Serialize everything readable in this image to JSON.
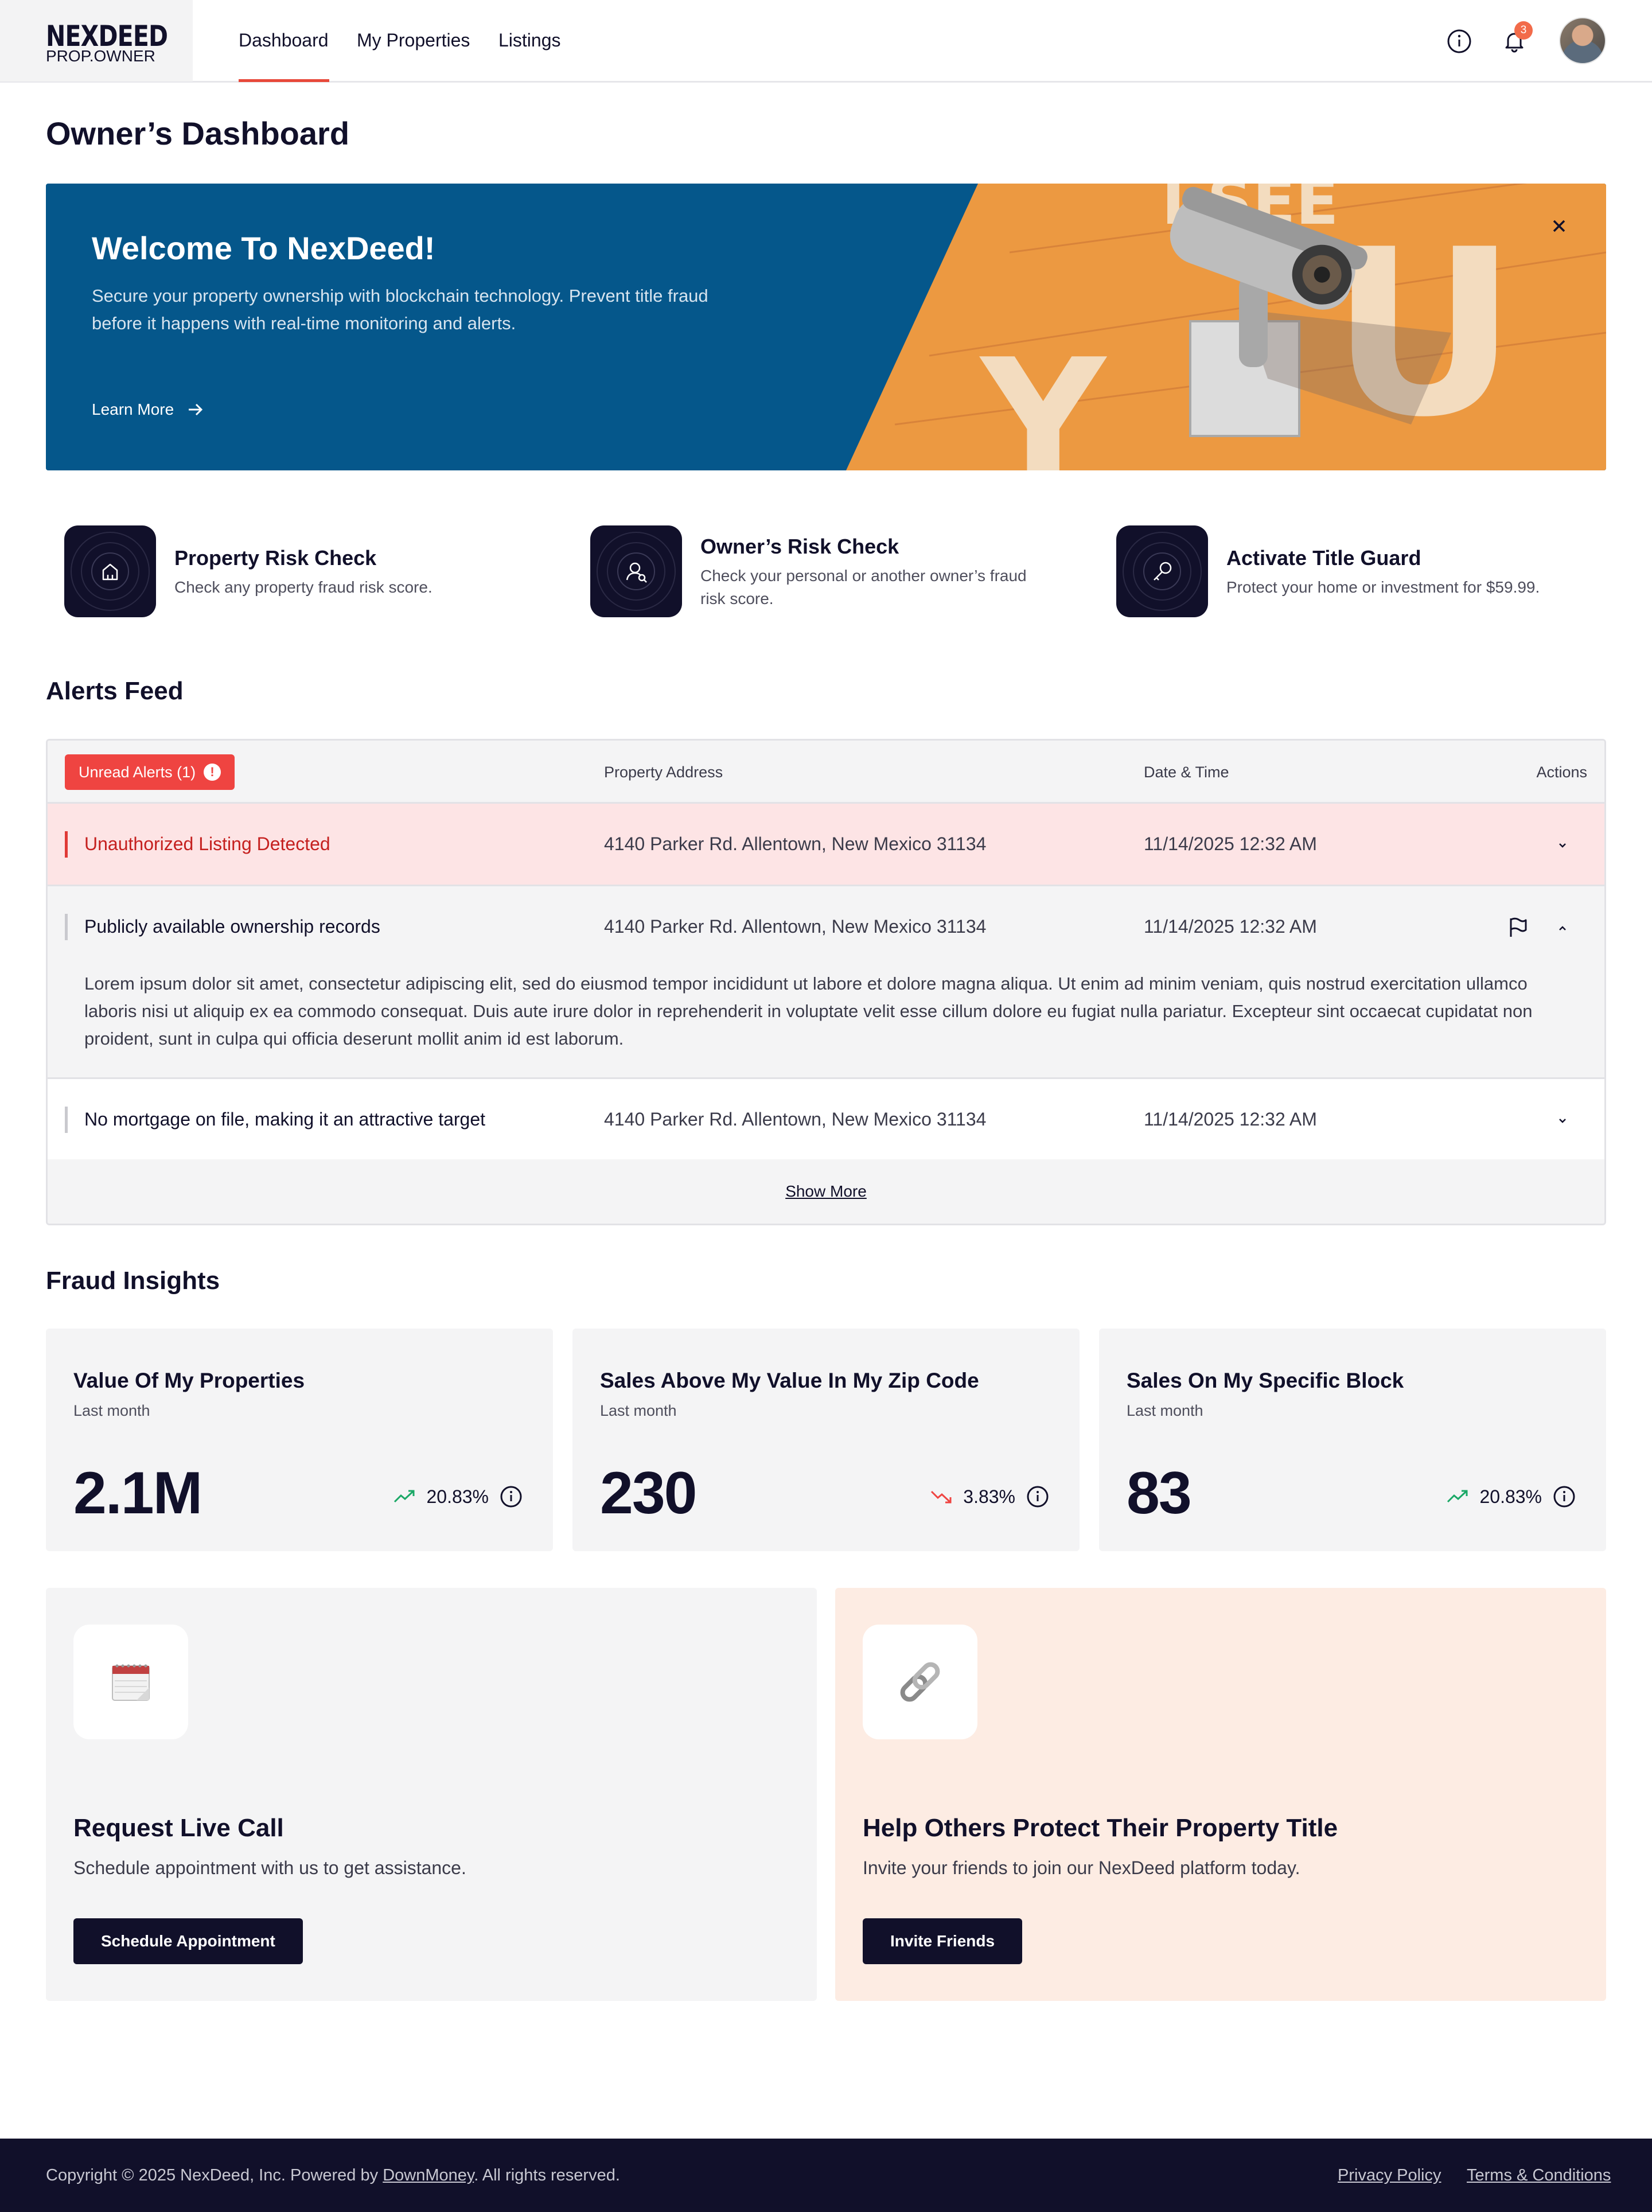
{
  "header": {
    "logo_main": "NEXDEED",
    "logo_sub": "PROP.OWNER",
    "nav": [
      "Dashboard",
      "My Properties",
      "Listings"
    ],
    "active_nav": "Dashboard",
    "notification_count": "3"
  },
  "page_title": "Owner’s Dashboard",
  "hero": {
    "title": "Welcome To NexDeed!",
    "text": "Secure your property ownership with blockchain technology. Prevent title fraud before it happens with real-time monitoring and alerts.",
    "link": "Learn More",
    "image_letters": [
      "Y",
      "U",
      "I SEE"
    ]
  },
  "quick_actions": [
    {
      "title": "Property Risk Check",
      "desc": "Check any property fraud risk score.",
      "icon": "home-icon"
    },
    {
      "title": "Owner’s Risk Check",
      "desc": "Check your personal or another owner’s fraud risk score.",
      "icon": "user-search-icon"
    },
    {
      "title": "Activate Title Guard",
      "desc": "Protect your home or investment for $59.99.",
      "icon": "key-icon"
    }
  ],
  "alerts": {
    "section_title": "Alerts Feed",
    "unread_label": "Unread Alerts (1)",
    "columns": {
      "address": "Property Address",
      "date": "Date & Time",
      "actions": "Actions"
    },
    "rows": [
      {
        "title": "Unauthorized Listing Detected",
        "address": "4140 Parker Rd. Allentown, New Mexico 31134",
        "date": "11/14/2025 12:32 AM",
        "unread": true
      },
      {
        "title": "Publicly available ownership records",
        "address": "4140 Parker Rd. Allentown, New Mexico 31134",
        "date": "11/14/2025 12:32 AM",
        "expanded": true,
        "body": "Lorem ipsum dolor sit amet, consectetur adipiscing elit, sed do eiusmod tempor incididunt ut labore et dolore magna aliqua. Ut enim ad minim veniam, quis nostrud exercitation ullamco laboris nisi  ut aliquip ex ea commodo consequat. Duis aute irure dolor in reprehenderit in voluptate velit esse cillum dolore eu fugiat nulla pariatur. Excepteur sint occaecat cupidatat non proident, sunt in culpa qui officia deserunt mollit anim id est laborum."
      },
      {
        "title": "No mortgage on file, making it an attractive target",
        "address": "4140 Parker Rd. Allentown, New Mexico 31134",
        "date": "11/14/2025 12:32 AM"
      }
    ],
    "show_more": "Show More"
  },
  "insights": {
    "section_title": "Fraud Insights",
    "cards": [
      {
        "title": "Value Of My Properties",
        "sub": "Last month",
        "value": "2.1M",
        "change": "20.83%",
        "trend": "up",
        "trend_color": "#1aa866"
      },
      {
        "title": "Sales Above My Value In My Zip Code",
        "sub": "Last month",
        "value": "230",
        "change": "3.83%",
        "trend": "down",
        "trend_color": "#ef4441"
      },
      {
        "title": "Sales On My Specific Block",
        "sub": "Last month",
        "value": "83",
        "change": "20.83%",
        "trend": "up",
        "trend_color": "#1aa866"
      }
    ]
  },
  "cta": [
    {
      "title": "Request Live Call",
      "text": "Schedule appointment with us to get assistance.",
      "button": "Schedule Appointment",
      "icon": "calendar-icon",
      "bg": "#f4f4f5"
    },
    {
      "title": "Help Others Protect Their Property Title",
      "text": "Invite your friends to join our NexDeed platform today.",
      "button": "Invite Friends",
      "icon": "link-icon",
      "bg": "#fdece3"
    }
  ],
  "footer": {
    "copyright_pre": "Copyright © 2025 NexDeed, Inc. Powered by ",
    "powered_by": "DownMoney",
    "copyright_post": ". All rights reserved.",
    "privacy": "Privacy Policy",
    "terms": "Terms & Conditions"
  }
}
